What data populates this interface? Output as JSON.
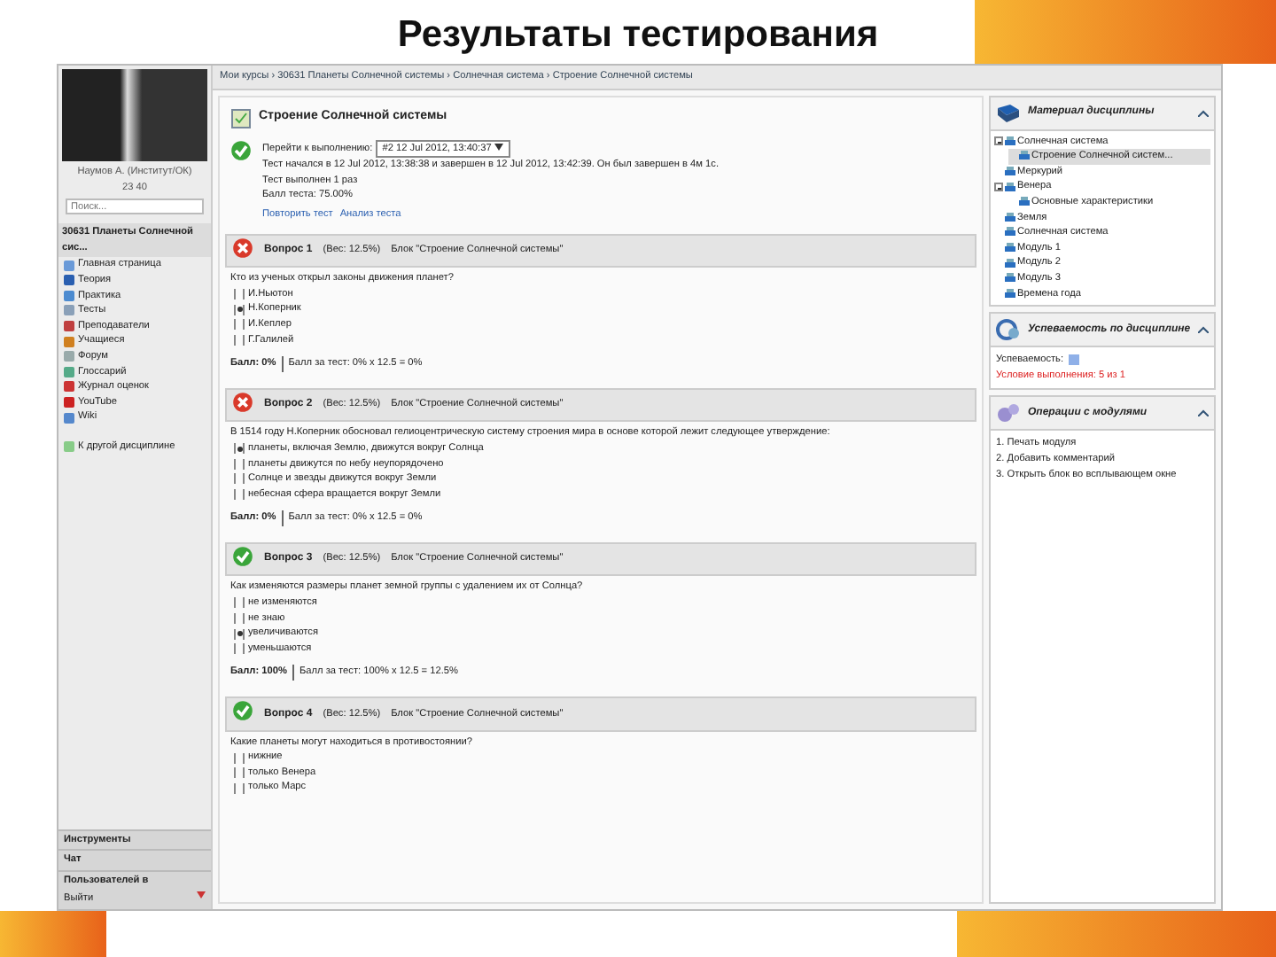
{
  "slide_title": "Результаты тестирования",
  "sidebar": {
    "user_name": "Наумов А. (Институт/ОК)",
    "user_stats": "23 40",
    "search": {
      "placeholder": "Поиск..."
    },
    "course_title": "30631 Планеты Солнечной сис...",
    "menu": [
      {
        "label": "Главная страница"
      },
      {
        "label": "Теория"
      },
      {
        "label": "Практика"
      },
      {
        "label": "Тесты"
      },
      {
        "label": "Преподаватели"
      },
      {
        "label": "Учащиеся"
      },
      {
        "label": "Форум"
      },
      {
        "label": "Глоссарий"
      },
      {
        "label": "Журнал оценок"
      },
      {
        "label": "YouTube"
      },
      {
        "label": "Wiki"
      }
    ],
    "other_course_link": "К другой дисциплине",
    "sections": [
      {
        "label": "Инструменты"
      },
      {
        "label": "Чат"
      },
      {
        "label": "Пользователей в"
      }
    ],
    "logout": "Выйти"
  },
  "breadcrumb": "Мои курсы › 30631 Планеты Солнечной системы › Солнечная система › Строение Солнечной системы",
  "quiz": {
    "title": "Строение Солнечной системы",
    "attempt_label": "Перейти к выполнению:",
    "attempt_value": "#2  12 Jul 2012, 13:40:37",
    "started_text": "Тест начался в 12 Jul 2012, 13:38:38 и завершен в 12 Jul 2012, 13:42:39. Он был завершен в 4м 1с.",
    "attempts_text": "Тест выполнен 1 раз",
    "score_text": "Балл теста: 75.00%",
    "links": [
      "Повторить тест",
      "Анализ теста"
    ]
  },
  "questions": [
    {
      "number": "Вопрос 1",
      "weight": "(Вес: 12.5%)",
      "block": "Блок \"Строение Солнечной системы\"",
      "correct": false,
      "text": "Кто из ученых открыл законы движения планет?",
      "options": [
        {
          "label": "И.Ньютон",
          "selected": false
        },
        {
          "label": "Н.Коперник",
          "selected": true
        },
        {
          "label": "И.Кеплер",
          "selected": false
        },
        {
          "label": "Г.Галилей",
          "selected": false
        }
      ],
      "score": "Балл: 0%",
      "test_score": "Балл за тест: 0% х 12.5 = 0%"
    },
    {
      "number": "Вопрос 2",
      "weight": "(Вес: 12.5%)",
      "block": "Блок \"Строение Солнечной системы\"",
      "correct": false,
      "text": "В 1514 году Н.Коперник обосновал гелиоцентрическую систему строения мира в основе которой лежит следующее утверждение:",
      "options": [
        {
          "label": "планеты, включая Землю, движутся вокруг Солнца",
          "selected": true
        },
        {
          "label": "планеты движутся по небу неупорядочено",
          "selected": false
        },
        {
          "label": "Солнце и звезды движутся вокруг Земли",
          "selected": false
        },
        {
          "label": "небесная сфера вращается вокруг Земли",
          "selected": false
        }
      ],
      "score": "Балл: 0%",
      "test_score": "Балл за тест: 0% х 12.5 = 0%"
    },
    {
      "number": "Вопрос 3",
      "weight": "(Вес: 12.5%)",
      "block": "Блок \"Строение Солнечной системы\"",
      "correct": true,
      "text": "Как изменяются размеры планет земной группы с удалением их от Солнца?",
      "options": [
        {
          "label": "не изменяются",
          "selected": false
        },
        {
          "label": "не знаю",
          "selected": false
        },
        {
          "label": "увеличиваются",
          "selected": true
        },
        {
          "label": "уменьшаются",
          "selected": false
        }
      ],
      "score": "Балл: 100%",
      "test_score": "Балл за тест: 100% х 12.5 = 12.5%"
    },
    {
      "number": "Вопрос 4",
      "weight": "(Вес: 12.5%)",
      "block": "Блок \"Строение Солнечной системы\"",
      "correct": true,
      "text": "Какие планеты могут находиться в противостоянии?",
      "options": [
        {
          "label": "нижние",
          "selected": false
        },
        {
          "label": "только Венера",
          "selected": false
        },
        {
          "label": "только Марс",
          "selected": false
        }
      ]
    }
  ],
  "materials": {
    "title": "Материал дисциплины",
    "tree": [
      {
        "label": "Солнечная система",
        "expanded": true,
        "selected": false,
        "children": [
          {
            "label": "Строение Солнечной систем...",
            "selected": true
          }
        ]
      },
      {
        "label": "Меркурий",
        "selected": false
      },
      {
        "label": "Венера",
        "expanded": true,
        "selected": false,
        "children": [
          {
            "label": "Основные характеристики",
            "selected": false
          }
        ]
      },
      {
        "label": "Земля",
        "selected": false
      },
      {
        "label": "Солнечная система",
        "selected": false
      },
      {
        "label": "Модуль 1",
        "selected": false
      },
      {
        "label": "Модуль 2",
        "selected": false
      },
      {
        "label": "Модуль 3",
        "selected": false
      },
      {
        "label": "Времена года",
        "selected": false
      }
    ]
  },
  "progress": {
    "title": "Успеваемость по дисциплине",
    "label": "Успеваемость:",
    "condition": "Условие выполнения: 5 из 1"
  },
  "operations": {
    "title": "Операции с модулями",
    "items": [
      "1. Печать модуля",
      "2. Добавить комментарий",
      "3. Открыть блок во всплывающем окне"
    ]
  }
}
